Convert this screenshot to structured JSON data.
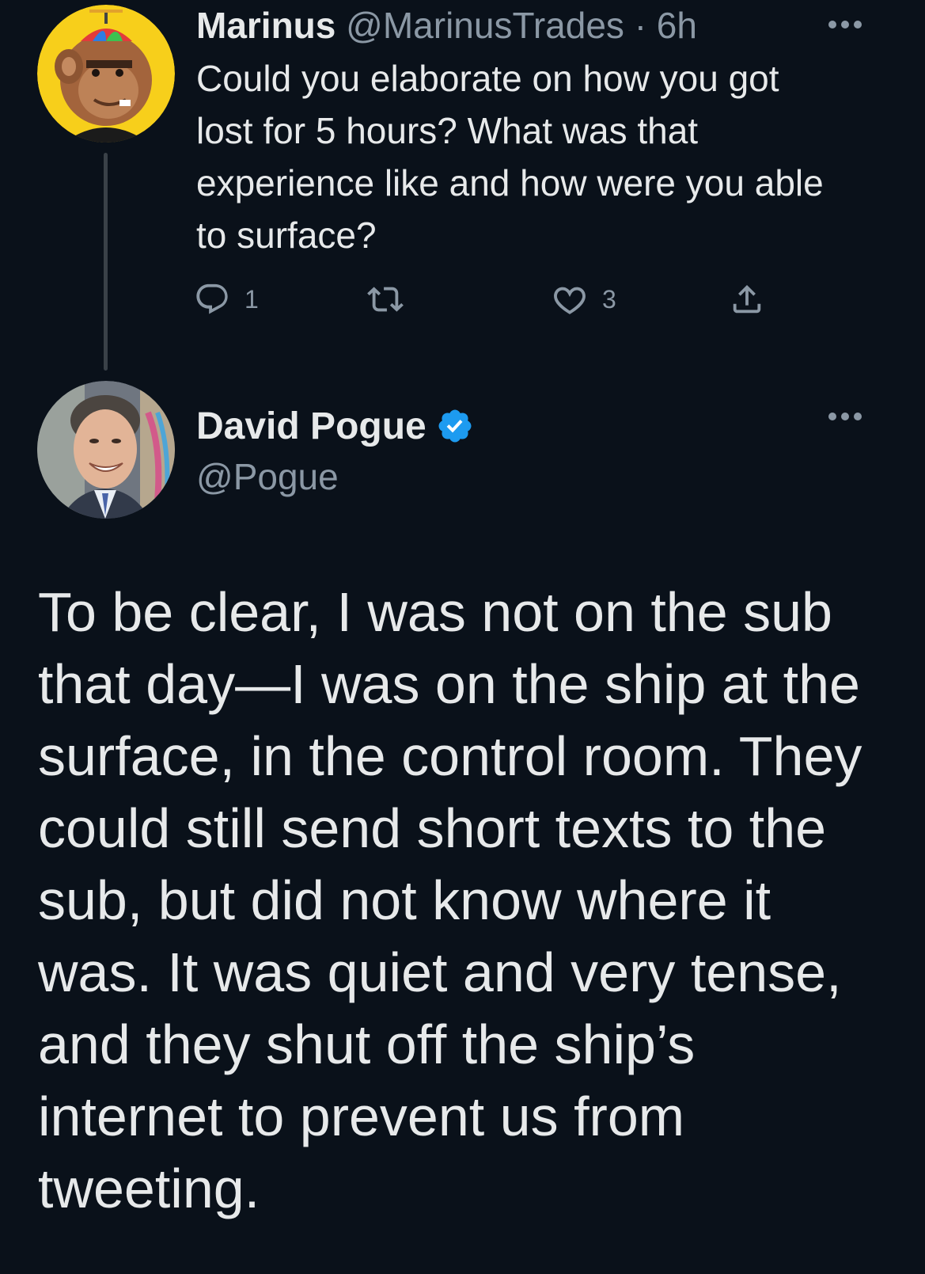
{
  "reply_tweet": {
    "author_name": "Marinus",
    "author_handle_time": "@MarinusTrades · 6h",
    "text": "Could you elaborate on how you got\nlost for 5 hours? What was that\nexperience like and how were you able\nto surface?",
    "actions": {
      "reply_count": "1",
      "retweet_count": "",
      "like_count": "3"
    },
    "avatar_icon": "ape-nft-avatar"
  },
  "main_tweet": {
    "author_name": "David Pogue",
    "author_handle": "@Pogue",
    "verified": true,
    "avatar_icon": "profile-photo",
    "text": "To be clear, I was not on the sub\nthat day—I was on the ship at the\nsurface, in the control room. They\ncould still send short texts to the\nsub, but did not know where it\nwas. It was quiet and very tense,\nand they shut off the ship’s\ninternet to prevent us from\ntweeting."
  },
  "colors": {
    "background": "#0a111a",
    "text_primary": "#e7e9ea",
    "text_secondary": "#8b98a5",
    "verified_blue": "#1d9bf0",
    "thread_line": "#3a4148"
  }
}
